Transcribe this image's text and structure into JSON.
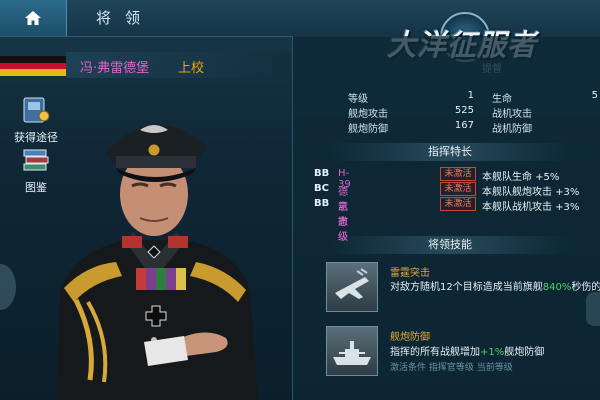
{
  "header": {
    "title": "将领"
  },
  "logo": {
    "text": "大洋征服者",
    "sub": "提督"
  },
  "officer": {
    "name": "冯·弗雷德堡",
    "rank": "上校"
  },
  "side_buttons": [
    {
      "label": "获得途径"
    },
    {
      "label": "图鉴"
    }
  ],
  "stats": {
    "level_label": "等级",
    "level_value": "1",
    "life_label": "生命",
    "life_value": "5",
    "gun_attack_label": "舰炮攻击",
    "gun_attack_value": "525",
    "fighter_attack_label": "战机攻击",
    "gun_defense_label": "舰炮防御",
    "gun_defense_value": "167",
    "fighter_defense_label": "战机防御"
  },
  "specialties": {
    "title": "指挥特长",
    "rows": [
      {
        "cls": "BB",
        "ship": "H-39",
        "status": "未激活",
        "effect": "本舰队生命 +5%"
      },
      {
        "cls": "BC",
        "ship": "德意志级",
        "status": "未激活",
        "effect": "本舰队舰炮攻击 +3%"
      },
      {
        "cls": "BB",
        "ship": "凯撒级",
        "status": "未激活",
        "effect": "本舰队战机攻击 +3%"
      }
    ]
  },
  "skills": {
    "title": "将领技能",
    "items": [
      {
        "name": "雷霆突击",
        "desc_a": "对敌方随机12个目标造成当前旗舰",
        "desc_hl": "840%",
        "desc_b": "秒伤的",
        "icon": "fighter-plane-icon"
      },
      {
        "name": "舰炮防御",
        "desc_a": "指挥的所有战舰增加",
        "desc_hl": "+1%",
        "desc_b": "舰炮防御",
        "icon": "battleship-icon"
      }
    ],
    "status_line": "激活条件 指挥官等级 当前等级"
  },
  "colors": {
    "accent_name": "#e063d0",
    "accent_rank": "#f2a400",
    "inactive": "#f07860",
    "highlight": "#4fd06a"
  }
}
